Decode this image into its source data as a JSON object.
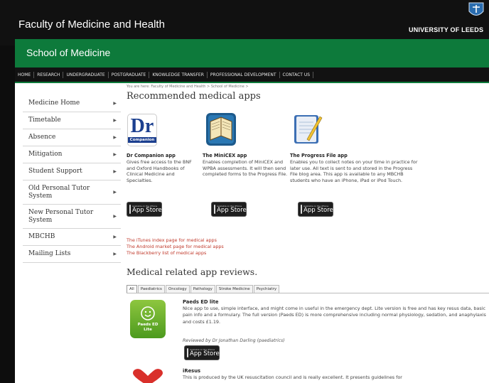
{
  "header": {
    "faculty_title": "Faculty of Medicine and Health",
    "university_name": "UNIVERSITY OF LEEDS"
  },
  "school": {
    "title": "School of Medicine"
  },
  "nav": [
    {
      "label": "HOME"
    },
    {
      "label": "RESEARCH"
    },
    {
      "label": "UNDERGRADUATE"
    },
    {
      "label": "POSTGRADUATE"
    },
    {
      "label": "KNOWLEDGE TRANSFER"
    },
    {
      "label": "PROFESSIONAL DEVELOPMENT"
    },
    {
      "label": "CONTACT US"
    }
  ],
  "sidebar": [
    {
      "label": "Medicine Home"
    },
    {
      "label": "Timetable"
    },
    {
      "label": "Absence"
    },
    {
      "label": "Mitigation"
    },
    {
      "label": "Student Support"
    },
    {
      "label": "Old Personal Tutor System"
    },
    {
      "label": "New Personal Tutor System"
    },
    {
      "label": "MBCHB"
    },
    {
      "label": "Mailing Lists"
    }
  ],
  "breadcrumb": "You are here: Faculty of Medicine and Health > School of Medicine >",
  "heading1": "Recommended medical apps",
  "apps": [
    {
      "icon_text": "Dr",
      "icon_subtext": "Companion",
      "title": "Dr Companion app",
      "desc": "Gives free access to the BNF and Oxford Handbooks of Clinical Medicine and Specialties."
    },
    {
      "title": "The MiniCEX app",
      "desc": "Enables completion of MiniCEX and WPBA assessments. It will then send completed forms to the Progress File."
    },
    {
      "title": "The Progress File app",
      "desc": "Enables you to collect notes on your time in practice for later use. All text is sent to and stored in the Progress File blog area. This app is available to any MBCHB students who have an iPhone, iPad or iPod Touch."
    }
  ],
  "appstore": {
    "small": "Available on the iPhone",
    "big": "App Store"
  },
  "links": [
    {
      "label": "The iTunes index page for medical apps"
    },
    {
      "label": "The Android market page for medical apps"
    },
    {
      "label": "The Blackberry list of medical apps"
    }
  ],
  "heading2": "Medical related app reviews.",
  "tabs": [
    {
      "label": "All"
    },
    {
      "label": "Paediatrics"
    },
    {
      "label": "Oncology"
    },
    {
      "label": "Pathology"
    },
    {
      "label": "Stroke Medicine"
    },
    {
      "label": "Psychiatry"
    }
  ],
  "reviews": [
    {
      "icon_text": "Paeds ED Lite",
      "title": "Paeds ED lite",
      "text": "Nice app to use, simple interface, and might come in useful in the emergency dept. Lite version is free and has key resus data, basic pain info and a formulary. The full version (Paeds ED) is more comprehensive including normal physiology, sedation, and anaphylaxis and costs £1.19.",
      "by": "Reviewed by Dr Jonathan Darling (paediatrics)"
    },
    {
      "title": "iResus",
      "text": "This is produced by the UK resuscitation council and is really excellent. It presents guidelines for"
    }
  ],
  "colors": {
    "school_green": "#0d7a3b",
    "link_red": "#c0392b"
  }
}
